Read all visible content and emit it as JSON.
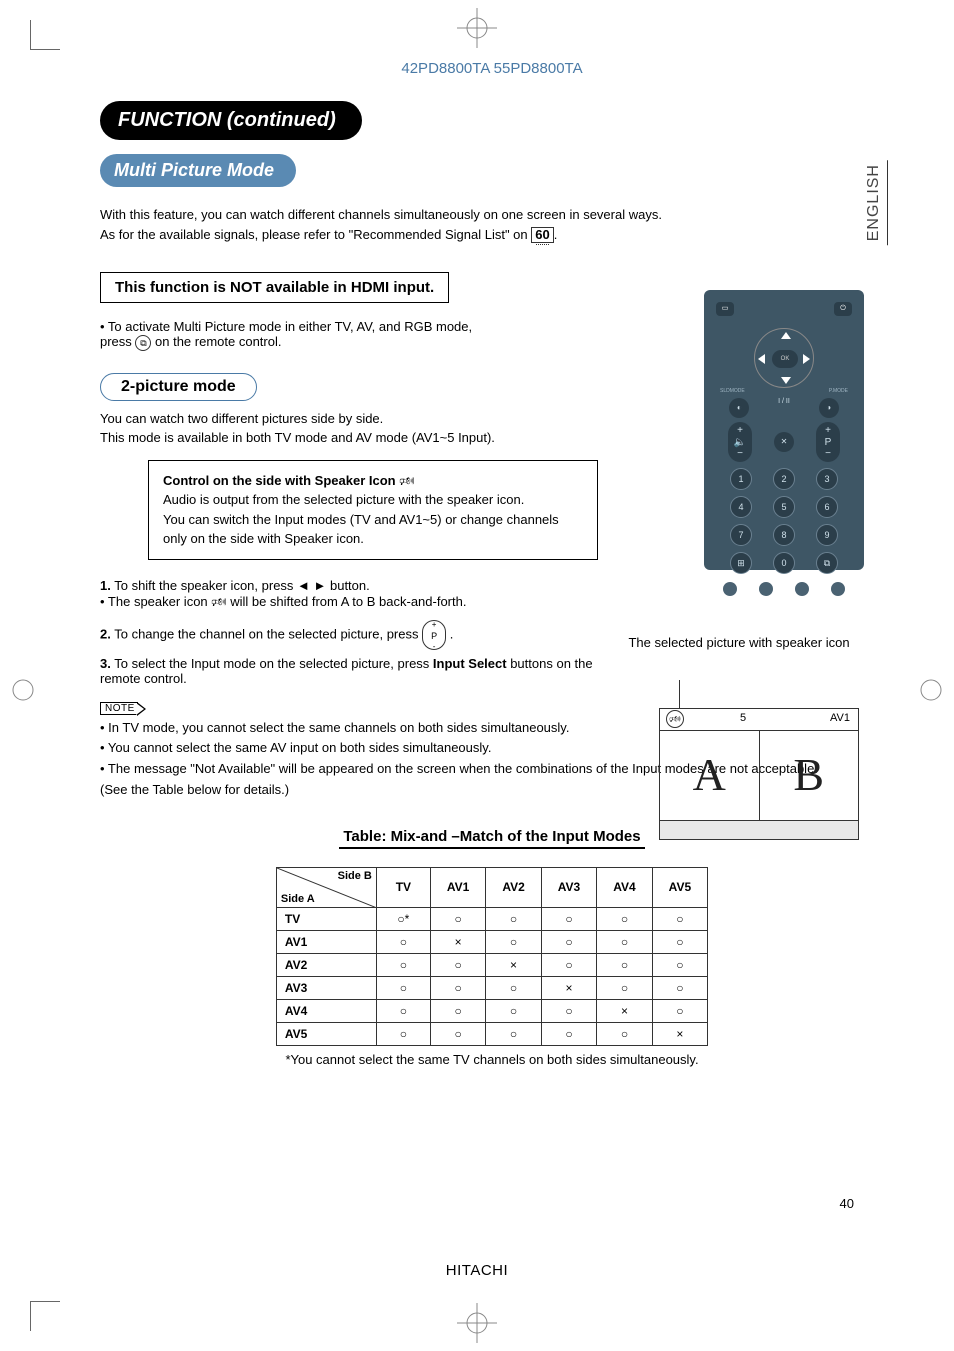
{
  "header": {
    "models": "42PD8800TA  55PD8800TA"
  },
  "lang_tab": "ENGLISH",
  "titles": {
    "function": "FUNCTION (continued)",
    "multi_picture": "Multi Picture Mode",
    "not_hdmi": "This function is NOT available in HDMI input.",
    "two_picture": "2-picture mode",
    "table": "Table: Mix-and –Match of the Input Modes"
  },
  "intro": {
    "line1": "With this feature, you can watch different channels simultaneously on one screen in several ways.",
    "line2a": "As for the available signals, please refer to \"Recommended Signal List\" on ",
    "line2_ref": "60",
    "line2b": "."
  },
  "activate": {
    "text_a": "• To activate Multi Picture mode in either TV, AV, and RGB mode,",
    "text_b": "  press ",
    "text_c": " on the remote control."
  },
  "two_pic_desc": {
    "l1": "You can watch two different pictures side by side.",
    "l2": "This mode is available in both TV mode and AV mode (AV1~5 Input)."
  },
  "inset": {
    "title": "Control on the side with Speaker Icon ",
    "l1": "Audio is output from the selected picture with the speaker icon.",
    "l2": "You can switch the Input modes (TV and AV1~5) or change channels only on the side with Speaker icon."
  },
  "steps": {
    "s1a": "1.",
    "s1b": " To shift the speaker icon, press ◄ ► button.",
    "s1c": "• The speaker icon ",
    "s1d": " will be shifted from A to B back-and-forth.",
    "s2a": "2.",
    "s2b": " To change the channel on the selected picture, press ",
    "s3a": "3.",
    "s3b": " To select the Input mode on the selected picture, press ",
    "s3c": "Input Select",
    "s3d": " buttons on the remote control."
  },
  "note_label": "NOTE",
  "notes": {
    "n1": "• In TV mode, you cannot select the same channels on both sides simultaneously.",
    "n2": "• You cannot select the same AV input on both sides simultaneously.",
    "n3": "• The message \"Not Available\" will be appeared on the screen when the combinations of the Input modes are not acceptable.",
    "n4": "  (See the Table below for details.)"
  },
  "diagram": {
    "caption": "The selected picture with speaker icon",
    "ch": "5",
    "av": "AV1",
    "A": "A",
    "B": "B"
  },
  "remote": {
    "ok": "OK",
    "labels": [
      "SLDMODE",
      "P.MODE"
    ],
    "vol_plus": "+",
    "vol_minus": "−",
    "p": "P",
    "mute": "✕",
    "iii": "I / II",
    "nums": [
      "1",
      "2",
      "3",
      "4",
      "5",
      "6",
      "7",
      "8",
      "9",
      "0"
    ],
    "enter": "⊞",
    "pip": "⧉"
  },
  "table": {
    "corner_b": "Side B",
    "corner_a": "Side A",
    "cols": [
      "TV",
      "AV1",
      "AV2",
      "AV3",
      "AV4",
      "AV5"
    ],
    "rows": [
      {
        "h": "TV",
        "c": [
          "○*",
          "○",
          "○",
          "○",
          "○",
          "○"
        ]
      },
      {
        "h": "AV1",
        "c": [
          "○",
          "×",
          "○",
          "○",
          "○",
          "○"
        ]
      },
      {
        "h": "AV2",
        "c": [
          "○",
          "○",
          "×",
          "○",
          "○",
          "○"
        ]
      },
      {
        "h": "AV3",
        "c": [
          "○",
          "○",
          "○",
          "×",
          "○",
          "○"
        ]
      },
      {
        "h": "AV4",
        "c": [
          "○",
          "○",
          "○",
          "○",
          "×",
          "○"
        ]
      },
      {
        "h": "AV5",
        "c": [
          "○",
          "○",
          "○",
          "○",
          "○",
          "×"
        ]
      }
    ],
    "foot": "*You cannot select the same TV channels on both sides simultaneously."
  },
  "footer": {
    "brand": "HITACHI",
    "page": "40"
  }
}
